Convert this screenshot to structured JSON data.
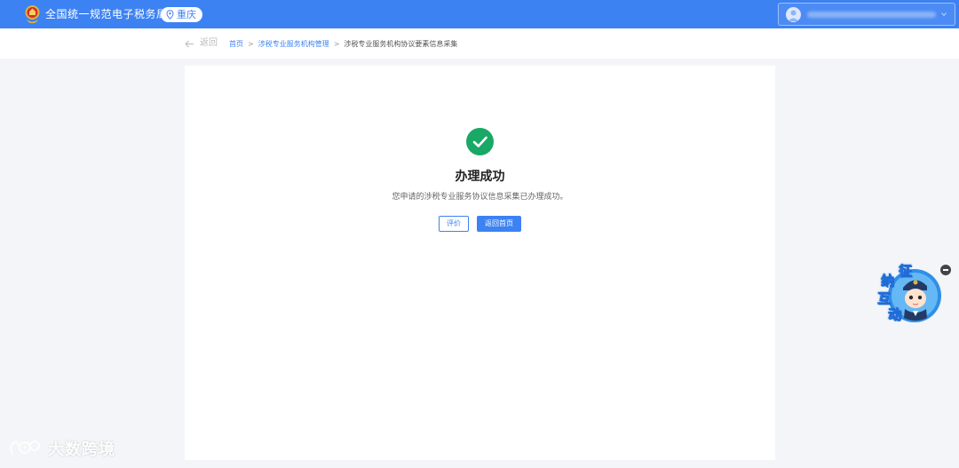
{
  "header": {
    "site_title": "全国统一规范电子税务局",
    "region": "重庆",
    "brand_color": "#3d82f2",
    "user_menu_icon": "chevron-down-icon"
  },
  "breadcrumb": {
    "back_label": "返回",
    "items": [
      "首页",
      "涉税专业服务机构管理",
      "涉税专业服务机构协议要素信息采集"
    ],
    "separator": ">"
  },
  "result": {
    "status_icon": "check-circle-icon",
    "status_color": "#1aa866",
    "title": "办理成功",
    "description": "您申请的涉税专业服务协议信息采集已办理成功。",
    "evaluate_label": "评价",
    "home_label": "返回首页"
  },
  "widget": {
    "chars": [
      "征",
      "纳",
      "互",
      "动"
    ]
  },
  "watermark": {
    "text": "大数跨境"
  }
}
